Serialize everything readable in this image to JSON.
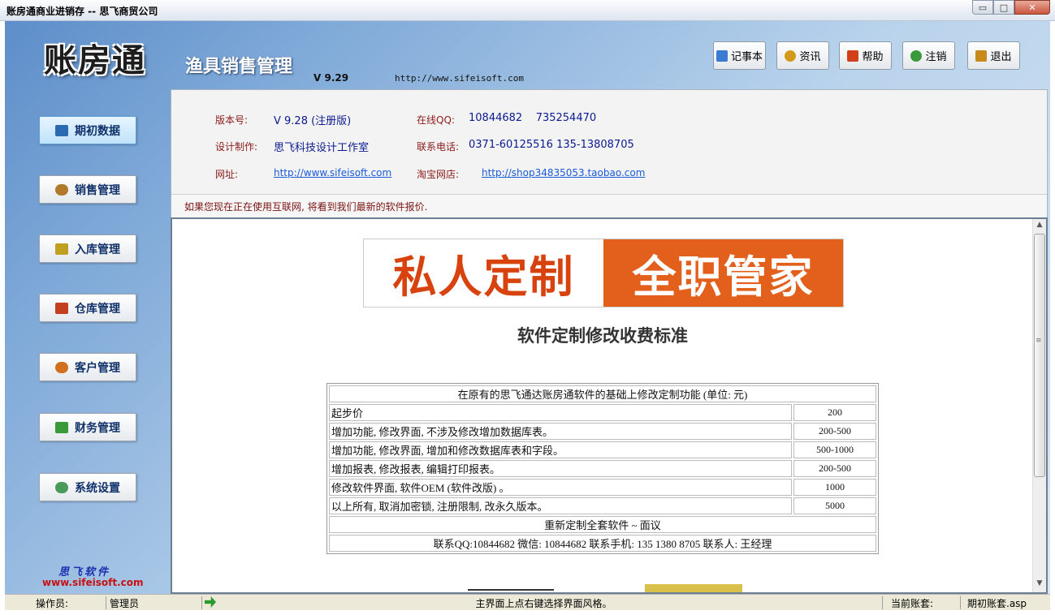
{
  "window": {
    "title": "账房通商业进销存 -- 思飞商贸公司",
    "min_glyph": "▭",
    "max_glyph": "□",
    "close_glyph": "✕"
  },
  "header": {
    "logo": "账房通",
    "module_title": "渔具销售管理",
    "version": "V 9.29",
    "website": "http://www.sifeisoft.com"
  },
  "toolbar": [
    {
      "label": "记事本",
      "icon": "notepad-icon",
      "color": "#3b7bd4"
    },
    {
      "label": "资讯",
      "icon": "news-icon",
      "color": "#d29a1a"
    },
    {
      "label": "帮助",
      "icon": "help-icon",
      "color": "#d2401a"
    },
    {
      "label": "注销",
      "icon": "logout-icon",
      "color": "#3a9a3a"
    },
    {
      "label": "退出",
      "icon": "exit-icon",
      "color": "#c88a1a"
    }
  ],
  "sidebar": {
    "items": [
      {
        "label": "期初数据",
        "icon": "book-icon",
        "color": "#2a6ab0",
        "active": true
      },
      {
        "label": "销售管理",
        "icon": "user-icon",
        "color": "#b07a2a"
      },
      {
        "label": "入库管理",
        "icon": "box-icon",
        "color": "#c0a020"
      },
      {
        "label": "仓库管理",
        "icon": "warehouse-icon",
        "color": "#c04020"
      },
      {
        "label": "客户管理",
        "icon": "customers-icon",
        "color": "#d07020"
      },
      {
        "label": "财务管理",
        "icon": "money-icon",
        "color": "#3a9a3a"
      },
      {
        "label": "系统设置",
        "icon": "settings-icon",
        "color": "#4a9a5a"
      }
    ],
    "brand_name": "思飞软件",
    "brand_url": "www.sifeisoft.com"
  },
  "info": {
    "version_label": "版本号:",
    "version_value": "V 9.28 (注册版)",
    "qq_label": "在线QQ:",
    "qq_value": "10844682    735254470",
    "design_label": "设计制作:",
    "design_value": "思飞科技设计工作室",
    "phone_label": "联系电话:",
    "phone_value": "0371-60125516 135-13808705",
    "url_label": "网址:",
    "url_value": "http://www.sifeisoft.com",
    "shop_label": "淘宝网店:",
    "shop_value": "http://shop34835053.taobao.com",
    "notice": "如果您现在正在使用互联网, 将看到我们最新的软件报价."
  },
  "page": {
    "banner_left": "私人定制",
    "banner_right": "全职管家",
    "price_title": "软件定制修改收费标准",
    "table_header": "在原有的思飞通达账房通软件的基础上修改定制功能 (单位: 元)",
    "rows": [
      {
        "item": "起步价",
        "price": "200"
      },
      {
        "item": "增加功能, 修改界面, 不涉及修改增加数据库表。",
        "price": "200-500"
      },
      {
        "item": "增加功能, 修改界面, 增加和修改数据库表和字段。",
        "price": "500-1000"
      },
      {
        "item": "增加报表, 修改报表, 编辑打印报表。",
        "price": "200-500"
      },
      {
        "item": "修改软件界面, 软件OEM (软件改版) 。",
        "price": "1000"
      },
      {
        "item": "以上所有, 取消加密锁, 注册限制, 改永久版本。",
        "price": "5000"
      }
    ],
    "custom_row": "重新定制全套软件 ~ 面议",
    "contact_row": "联系QQ:10844682 微信: 10844682 联系手机:  135 1380 8705 联系人: 王经理"
  },
  "statusbar": {
    "operator_label": "操作员:",
    "operator_value": "管理员",
    "hint": "主界面上点右键选择界面风格。",
    "account_label": "当前账套:",
    "account_value": "期初账套.asp"
  }
}
